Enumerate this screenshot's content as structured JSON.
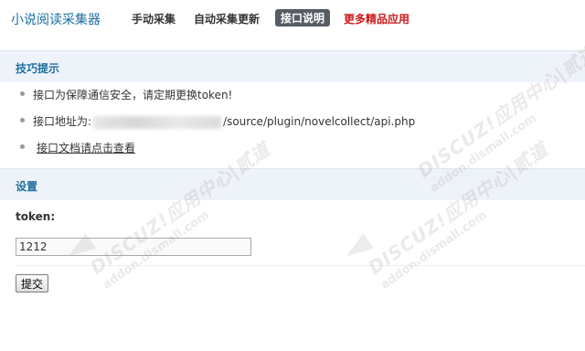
{
  "header": {
    "app_title": "小说阅读采集器",
    "nav": [
      {
        "label": "手动采集"
      },
      {
        "label": "自动采集更新"
      },
      {
        "label": "接口说明"
      },
      {
        "label": "更多精品应用"
      }
    ]
  },
  "tips_section": {
    "title": "技巧提示",
    "items": [
      {
        "text": "接口为保障通信安全，请定期更换token!"
      },
      {
        "prefix": "接口地址为:",
        "suffix": "/source/plugin/novelcollect/api.php"
      },
      {
        "link": "接口文档请点击查看"
      }
    ]
  },
  "settings_section": {
    "title": "设置",
    "token_label": "token:",
    "token_value": "1212",
    "submit_label": "提交"
  },
  "watermark": {
    "main": "DISCUZ!应用中心|贰道",
    "sub": "addon.dismall.com"
  },
  "colors": {
    "accent": "#1f6f9e",
    "active_tab_bg": "#555c63",
    "promo": "#cc1a1a",
    "section_bg": "#eef3f9"
  }
}
